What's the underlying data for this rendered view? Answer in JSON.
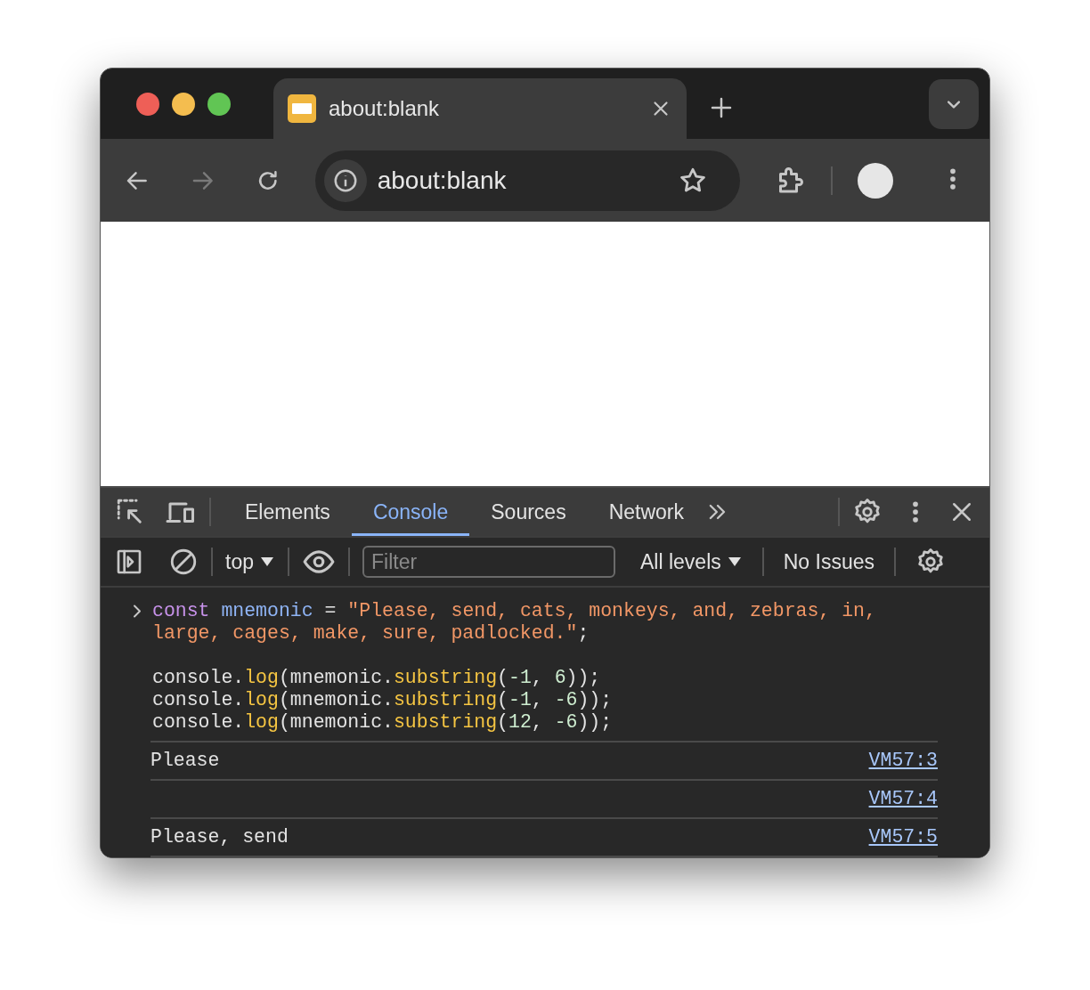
{
  "browser": {
    "tab": {
      "title": "about:blank",
      "selected": true
    },
    "address": "about:blank"
  },
  "devtools": {
    "tabs": [
      {
        "label": "Elements",
        "selected": false
      },
      {
        "label": "Console",
        "selected": true
      },
      {
        "label": "Sources",
        "selected": false
      },
      {
        "label": "Network",
        "selected": false
      }
    ],
    "toolbar": {
      "context": "top",
      "filter_placeholder": "Filter",
      "levels": "All levels",
      "issues": "No Issues"
    },
    "console": {
      "input_blocks": [
        {
          "lines": [
            [
              {
                "kind": "keyword",
                "text": "const"
              },
              {
                "kind": "variable",
                "text": " mnemonic"
              },
              {
                "kind": "plain",
                "text": " = "
              },
              {
                "kind": "string",
                "text": "\"Please, send, cats, monkeys, and, zebras, in, large, cages, make, sure, padlocked.\""
              },
              {
                "kind": "plain",
                "text": ";"
              }
            ]
          ]
        },
        {
          "lines": [
            [
              {
                "kind": "plain",
                "text": "console."
              },
              {
                "kind": "method",
                "text": "log"
              },
              {
                "kind": "plain",
                "text": "(mnemonic."
              },
              {
                "kind": "method",
                "text": "substring"
              },
              {
                "kind": "plain",
                "text": "("
              },
              {
                "kind": "number",
                "text": "-1"
              },
              {
                "kind": "plain",
                "text": ", "
              },
              {
                "kind": "number",
                "text": "6"
              },
              {
                "kind": "plain",
                "text": "));"
              }
            ],
            [
              {
                "kind": "plain",
                "text": "console."
              },
              {
                "kind": "method",
                "text": "log"
              },
              {
                "kind": "plain",
                "text": "(mnemonic."
              },
              {
                "kind": "method",
                "text": "substring"
              },
              {
                "kind": "plain",
                "text": "("
              },
              {
                "kind": "number",
                "text": "-1"
              },
              {
                "kind": "plain",
                "text": ", "
              },
              {
                "kind": "number",
                "text": "-6"
              },
              {
                "kind": "plain",
                "text": "));"
              }
            ],
            [
              {
                "kind": "plain",
                "text": "console."
              },
              {
                "kind": "method",
                "text": "log"
              },
              {
                "kind": "plain",
                "text": "(mnemonic."
              },
              {
                "kind": "method",
                "text": "substring"
              },
              {
                "kind": "plain",
                "text": "("
              },
              {
                "kind": "number",
                "text": "12"
              },
              {
                "kind": "plain",
                "text": ", "
              },
              {
                "kind": "number",
                "text": "-6"
              },
              {
                "kind": "plain",
                "text": "));"
              }
            ]
          ]
        }
      ],
      "logs": [
        {
          "text": "Please",
          "source": "VM57:3"
        },
        {
          "source": "VM57:4"
        },
        {
          "text": "Please, send",
          "source": "VM57:5"
        }
      ]
    }
  }
}
